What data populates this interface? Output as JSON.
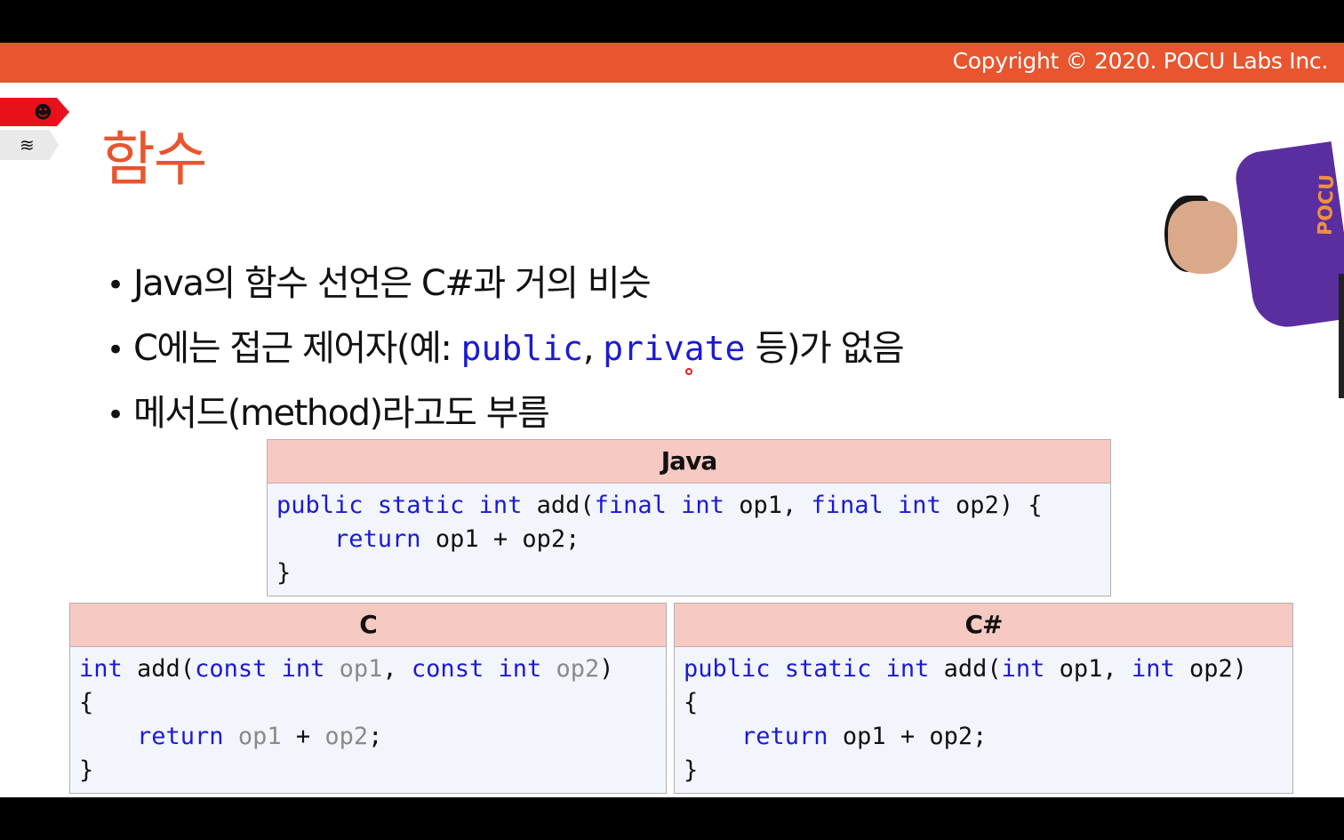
{
  "header": {
    "copyright": "Copyright © 2020. POCU Labs Inc."
  },
  "slide": {
    "title": "함수",
    "icons": [
      "brain-icon",
      "books-icon"
    ],
    "bullets": {
      "b1": "Java의 함수 선언은 C#과 거의 비슷",
      "b2_pre": "C에는 접근 제어자(예: ",
      "b2_kw1": "public",
      "b2_sep": ", ",
      "b2_kw2": "private",
      "b2_post": " 등)가 없음",
      "b3": "메서드(method)라고도 부름"
    },
    "java_box": {
      "title": "Java",
      "lines": [
        [
          [
            "k",
            "public static int"
          ],
          [
            "t",
            " add("
          ],
          [
            "k",
            "final int"
          ],
          [
            "t",
            " op1, "
          ],
          [
            "k",
            "final int"
          ],
          [
            "t",
            " op2) {"
          ]
        ],
        [
          [
            "t",
            "    "
          ],
          [
            "k",
            "return"
          ],
          [
            "t",
            " op1 + op2;"
          ]
        ],
        [
          [
            "t",
            "}"
          ]
        ]
      ]
    },
    "c_box": {
      "title": "C",
      "lines": [
        [
          [
            "k",
            "int"
          ],
          [
            "t",
            " add("
          ],
          [
            "k",
            "const int"
          ],
          [
            "g",
            " op1"
          ],
          [
            "t",
            ", "
          ],
          [
            "k",
            "const int"
          ],
          [
            "g",
            " op2"
          ],
          [
            "t",
            ")"
          ]
        ],
        [
          [
            "t",
            "{"
          ]
        ],
        [
          [
            "t",
            "    "
          ],
          [
            "k",
            "return"
          ],
          [
            "g",
            " op1"
          ],
          [
            "t",
            " + "
          ],
          [
            "g",
            "op2"
          ],
          [
            "t",
            ";"
          ]
        ],
        [
          [
            "t",
            "}"
          ]
        ]
      ]
    },
    "cs_box": {
      "title": "C#",
      "lines": [
        [
          [
            "k",
            "public static int"
          ],
          [
            "t",
            " add("
          ],
          [
            "k",
            "int"
          ],
          [
            "t",
            " op1, "
          ],
          [
            "k",
            "int"
          ],
          [
            "t",
            " op2)"
          ]
        ],
        [
          [
            "t",
            "{"
          ]
        ],
        [
          [
            "t",
            "    "
          ],
          [
            "k",
            "return"
          ],
          [
            "t",
            " op1 + op2;"
          ]
        ],
        [
          [
            "t",
            "}"
          ]
        ]
      ]
    },
    "presenter_shirt_text": "POCU"
  }
}
